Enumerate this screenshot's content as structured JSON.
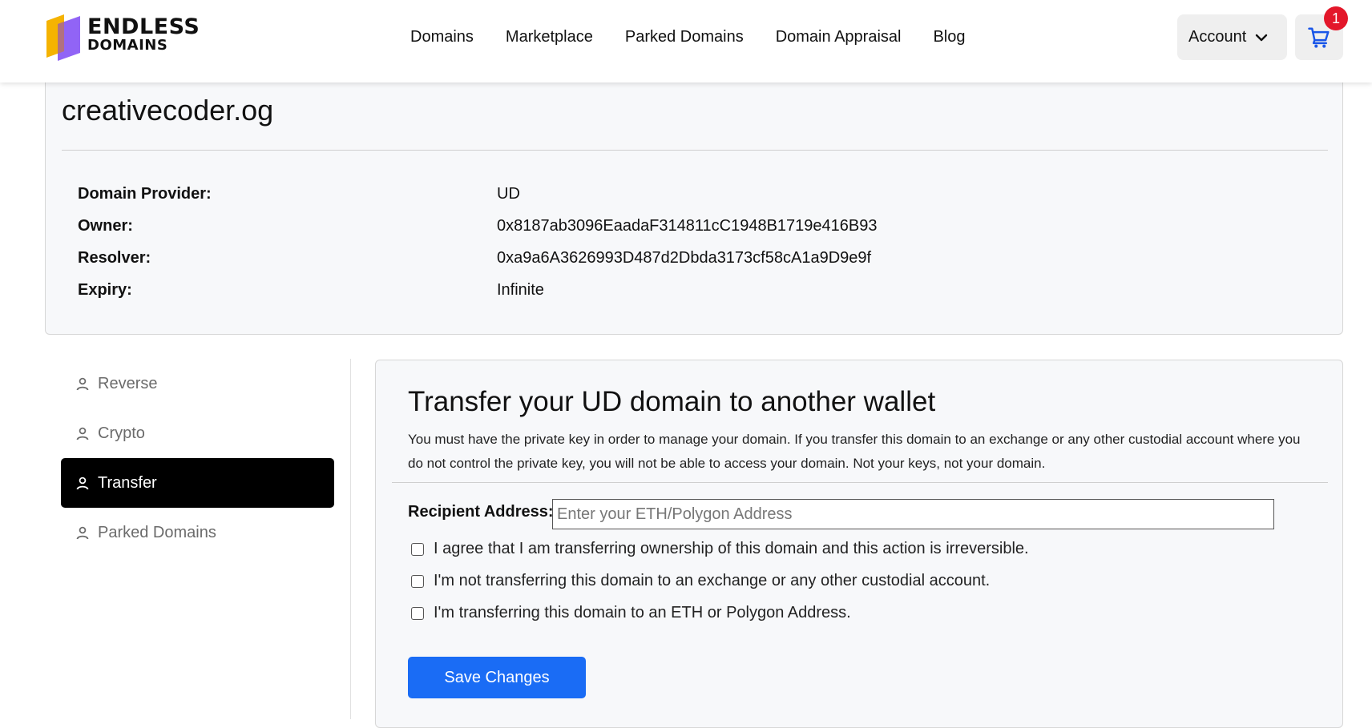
{
  "header": {
    "logo_line1": "ENDLESS",
    "logo_line2": "DOMAINS",
    "nav": [
      "Domains",
      "Marketplace",
      "Parked Domains",
      "Domain Appraisal",
      "Blog"
    ],
    "account_label": "Account",
    "cart_count": "1",
    "colors": {
      "cart_badge": "#e3172a",
      "cart_icon": "#1a56e8"
    }
  },
  "domain": {
    "name": "creativecoder.og",
    "fields": [
      {
        "label": "Domain Provider:",
        "value": "UD"
      },
      {
        "label": "Owner:",
        "value": "0x8187ab3096EaadaF314811cC1948B1719e416B93"
      },
      {
        "label": "Resolver:",
        "value": "0xa9a6A3626993D487d2Dbda3173cf58cA1a9D9e9f"
      },
      {
        "label": "Expiry:",
        "value": "Infinite"
      }
    ]
  },
  "sidebar": {
    "items": [
      {
        "label": "Reverse",
        "icon": "user-icon",
        "active": false
      },
      {
        "label": "Crypto",
        "icon": "user-icon",
        "active": false
      },
      {
        "label": "Transfer",
        "icon": "user-icon",
        "active": true
      },
      {
        "label": "Parked Domains",
        "icon": "user-icon",
        "active": false
      }
    ]
  },
  "transfer": {
    "title": "Transfer your UD domain to another wallet",
    "description": "You must have the private key in order to manage your domain. If you transfer this domain to an exchange or any other custodial account where you do not control the private key, you will not be able to access your domain. Not your keys, not your domain.",
    "recipient_label": "Recipient Address:",
    "recipient_placeholder": "Enter your ETH/Polygon Address",
    "recipient_value": "",
    "checkboxes": [
      {
        "label": "I agree that I am transferring ownership of this domain and this action is irreversible.",
        "checked": false
      },
      {
        "label": "I'm not transferring this domain to an exchange or any other custodial account.",
        "checked": false
      },
      {
        "label": "I'm transferring this domain to an ETH or Polygon Address.",
        "checked": false
      }
    ],
    "save_label": "Save Changes",
    "colors": {
      "save_button": "#1a6cf5"
    }
  }
}
